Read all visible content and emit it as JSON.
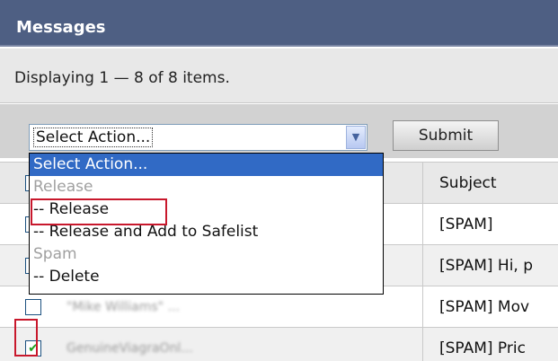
{
  "panel": {
    "title": "Messages",
    "display_text": "Displaying 1 — 8 of 8 items."
  },
  "toolbar": {
    "select_value": "Select Action...",
    "submit_label": "Submit"
  },
  "dropdown": {
    "options": [
      {
        "label": "Select Action...",
        "kind": "selected"
      },
      {
        "label": "Release",
        "kind": "group"
      },
      {
        "label": "-- Release",
        "kind": "option"
      },
      {
        "label": "-- Release and Add to Safelist",
        "kind": "option"
      },
      {
        "label": "Spam",
        "kind": "group"
      },
      {
        "label": "-- Delete",
        "kind": "option"
      }
    ]
  },
  "table": {
    "subject_header": "Subject",
    "rows": [
      {
        "from": "",
        "subject": "[SPAM]",
        "checked": false
      },
      {
        "from": "",
        "subject": "[SPAM] Hi, p",
        "checked": false
      },
      {
        "from": "\"Mike Williams\" ...",
        "subject": "[SPAM] Mov",
        "checked": false
      },
      {
        "from": "GenuineViagraOnl...",
        "subject": "[SPAM] Pric",
        "checked": true
      }
    ]
  },
  "colors": {
    "header_bg": "#4e5f83",
    "selected_option_bg": "#316ac5",
    "highlight_border": "#c8182c"
  }
}
